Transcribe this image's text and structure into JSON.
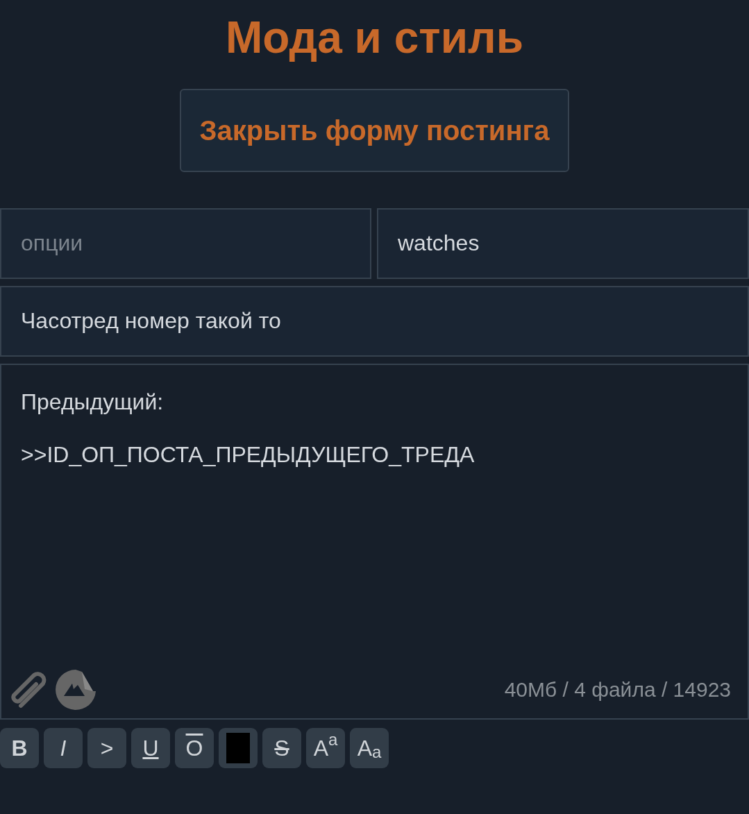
{
  "title": "Мода и стиль",
  "close_button": "Закрыть форму постинга",
  "options_field": {
    "placeholder": "опции"
  },
  "name_field": {
    "value": "watches"
  },
  "subject_field": {
    "value": "Часотред номер такой то"
  },
  "message_field": {
    "value": "Предыдущий:\n\n>>ID_ОП_ПОСТА_ПРЕДЫДУЩЕГО_ТРЕДА",
    "counter": "40Мб / 4 файла / 14923"
  },
  "format_buttons": [
    {
      "kind": "bold",
      "label": "B"
    },
    {
      "kind": "italic",
      "label": "I"
    },
    {
      "kind": "quote",
      "label": ">"
    },
    {
      "kind": "underline",
      "label": "U"
    },
    {
      "kind": "overline",
      "label": "O"
    },
    {
      "kind": "spoiler"
    },
    {
      "kind": "strike",
      "label": "S"
    },
    {
      "kind": "sup",
      "label": "A$^{a}$"
    },
    {
      "kind": "sub",
      "label": "A$_{a}$"
    }
  ]
}
